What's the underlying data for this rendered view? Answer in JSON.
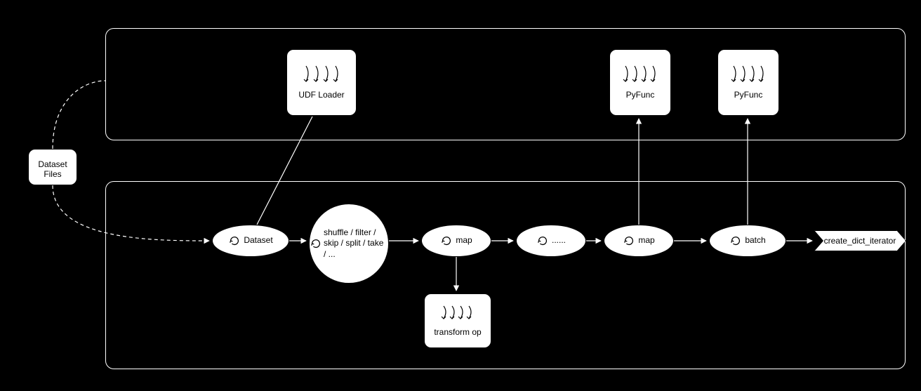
{
  "files_card": {
    "label": "Dataset\nFiles"
  },
  "udf_loader": {
    "label": "UDF Loader"
  },
  "pyfunc1": {
    "label": "PyFunc"
  },
  "pyfunc2": {
    "label": "PyFunc"
  },
  "dataset_node": {
    "label": "Dataset"
  },
  "ops_circle": {
    "label": "shuffle /\nfilter /\nskip /\nsplit /\ntake /\n..."
  },
  "map1": {
    "label": "map"
  },
  "ellipsis": {
    "label": "......"
  },
  "map2": {
    "label": "map"
  },
  "batch": {
    "label": "batch"
  },
  "transform_op": {
    "label": "transform op"
  },
  "iterator": {
    "label": "create_dict_iterator"
  }
}
